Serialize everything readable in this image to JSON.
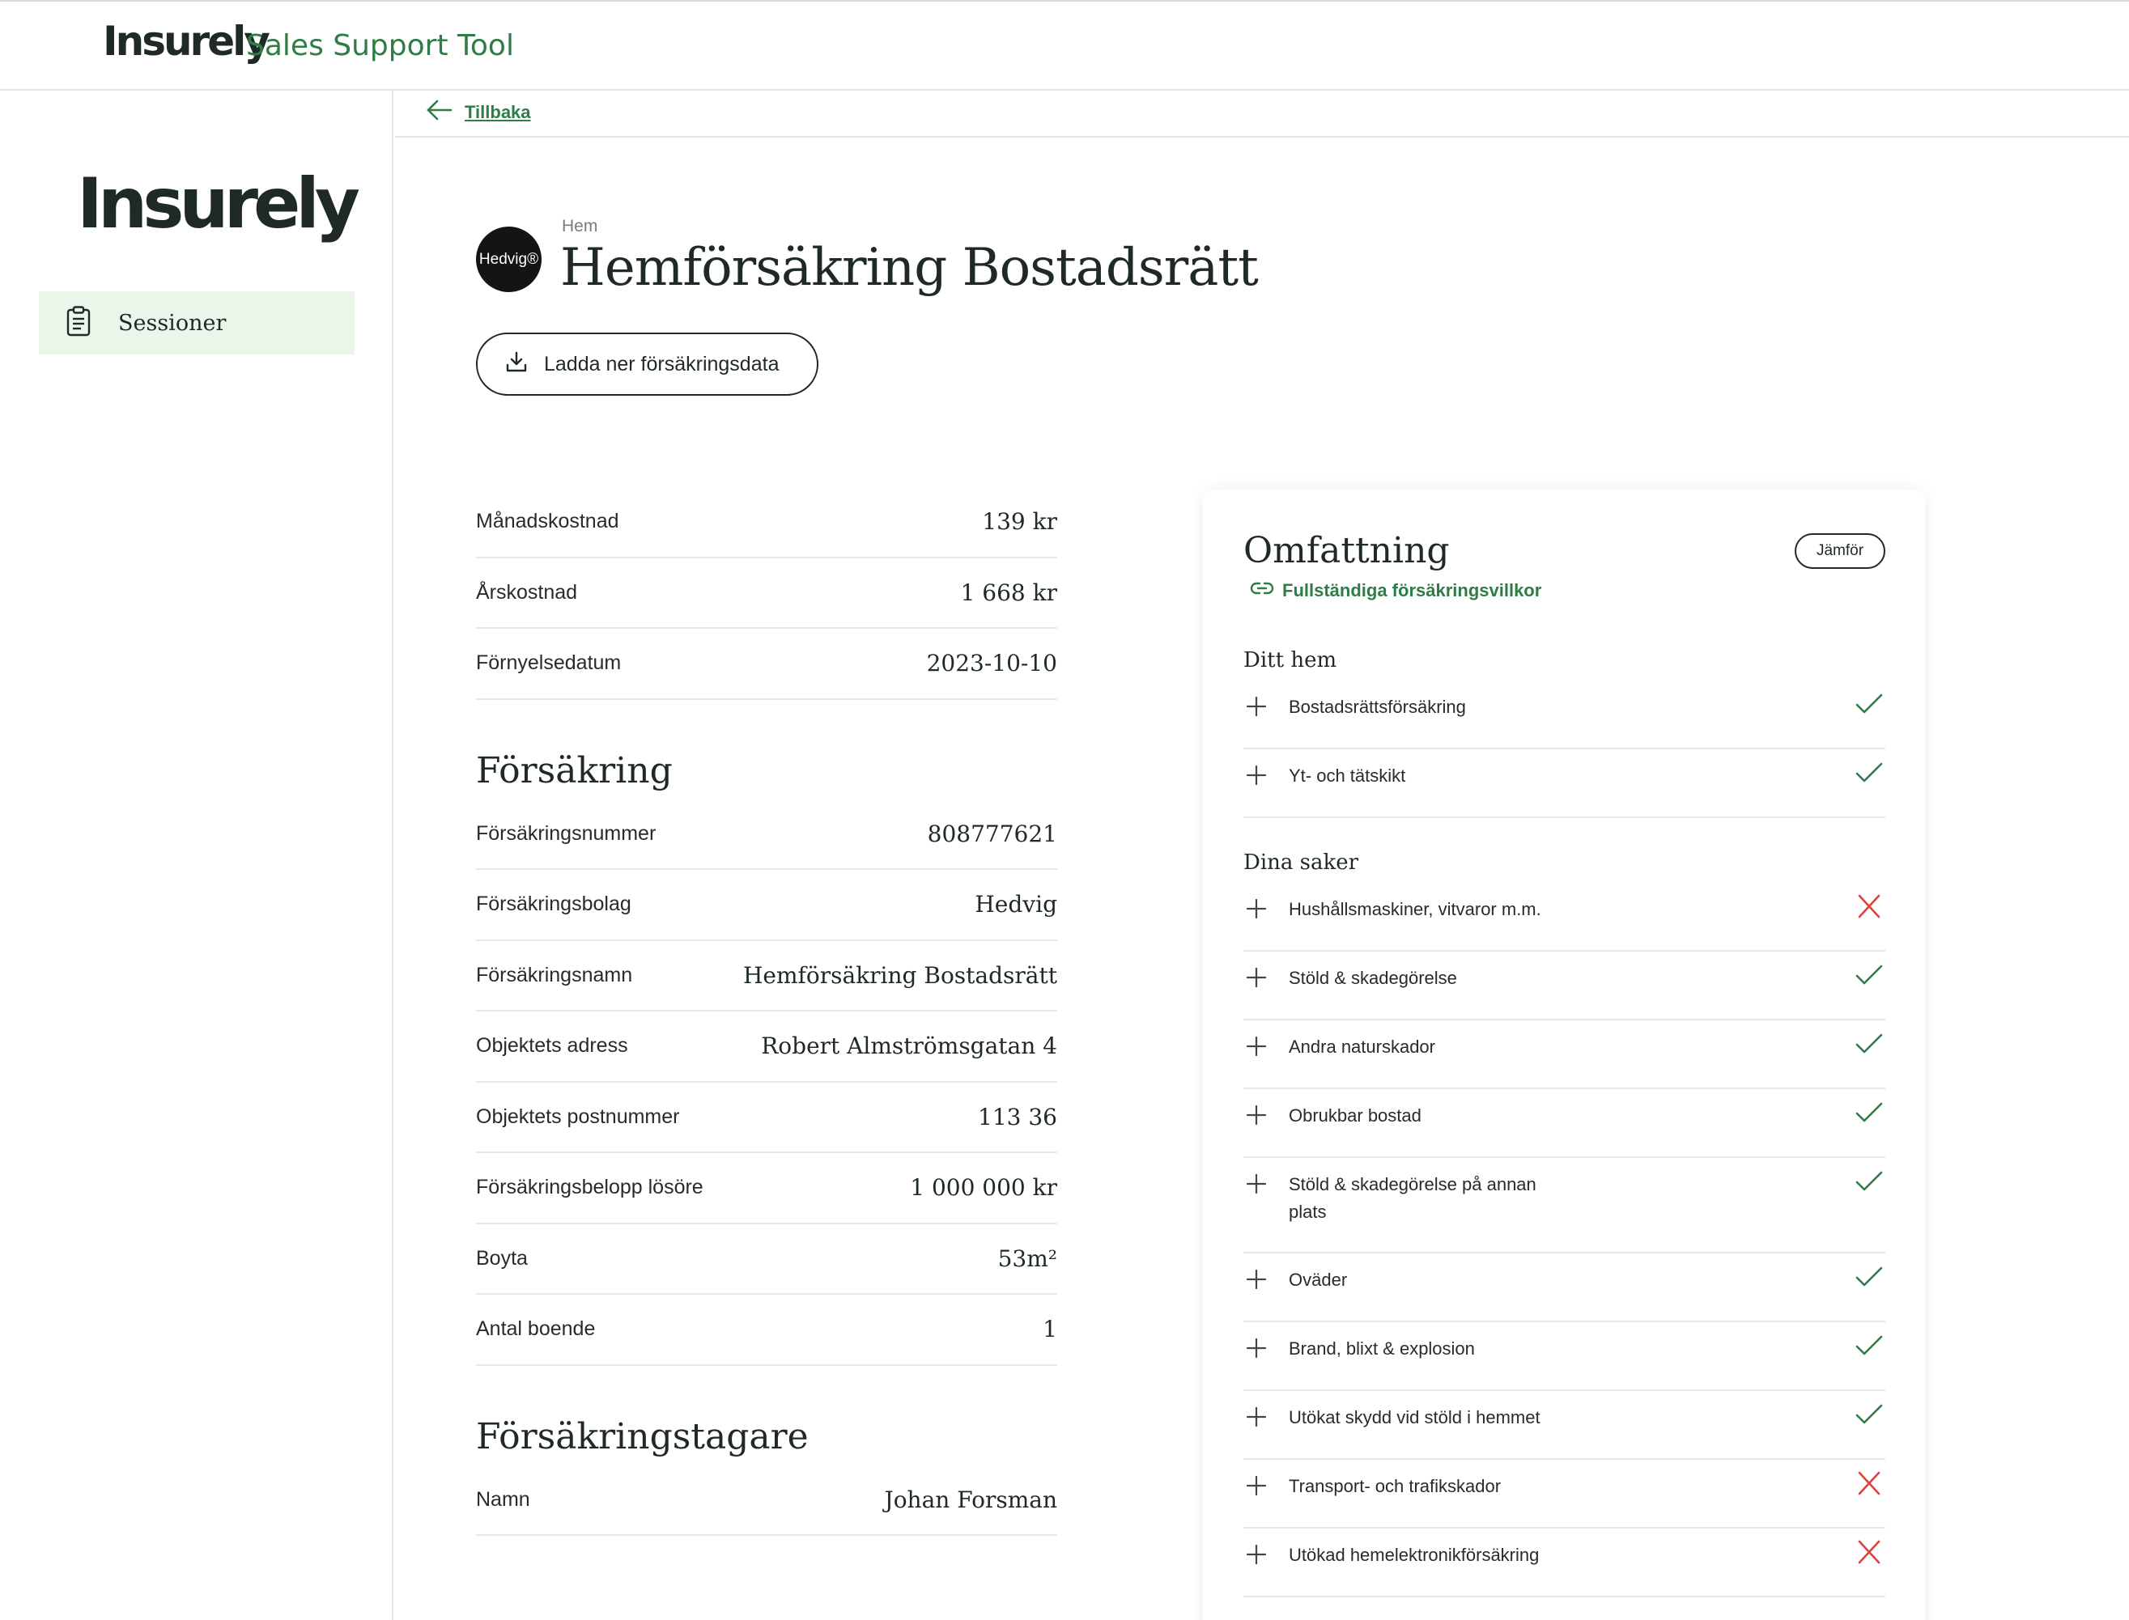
{
  "topbar": {
    "brand": "Insurely",
    "tool_name": "Sales Support Tool"
  },
  "sidebar": {
    "logo": "Insurely",
    "items": [
      {
        "label": "Sessioner",
        "icon": "clipboard-icon"
      }
    ]
  },
  "back": {
    "label": "Tillbaka"
  },
  "header": {
    "category": "Hem",
    "title": "Hemförsäkring Bostadsrätt",
    "company_badge": "Hedvig®"
  },
  "download": {
    "label": "Ladda ner försäkringsdata"
  },
  "costs": [
    {
      "label": "Månadskostnad",
      "value": "139 kr"
    },
    {
      "label": "Årskostnad",
      "value": "1 668 kr"
    },
    {
      "label": "Förnyelsedatum",
      "value": "2023-10-10"
    }
  ],
  "insurance": {
    "title": "Försäkring",
    "rows": [
      {
        "label": "Försäkringsnummer",
        "value": "808777621"
      },
      {
        "label": "Försäkringsbolag",
        "value": "Hedvig"
      },
      {
        "label": "Försäkringsnamn",
        "value": "Hemförsäkring Bostadsrätt"
      },
      {
        "label": "Objektets adress",
        "value": "Robert Almströmsgatan 4"
      },
      {
        "label": "Objektets postnummer",
        "value": "113 36"
      },
      {
        "label": "Försäkringsbelopp lösöre",
        "value": "1 000 000 kr"
      },
      {
        "label": "Boyta",
        "value": "53m²"
      },
      {
        "label": "Antal boende",
        "value": "1"
      }
    ]
  },
  "policyholder": {
    "title": "Försäkringstagare",
    "rows": [
      {
        "label": "Namn",
        "value": "Johan Forsman"
      }
    ]
  },
  "coverage": {
    "title": "Omfattning",
    "compare_label": "Jämför",
    "terms_link": "Fullständiga försäkringsvillkor",
    "colors": {
      "included": "#2f7d46",
      "excluded": "#e0413a"
    },
    "groups": [
      {
        "title": "Ditt hem",
        "items": [
          {
            "label": "Bostadsrättsförsäkring",
            "included": true
          },
          {
            "label": "Yt- och tätskikt",
            "included": true
          }
        ]
      },
      {
        "title": "Dina saker",
        "items": [
          {
            "label": "Hushållsmaskiner, vitvaror m.m.",
            "included": false
          },
          {
            "label": "Stöld & skadegörelse",
            "included": true
          },
          {
            "label": "Andra naturskador",
            "included": true
          },
          {
            "label": "Obrukbar bostad",
            "included": true
          },
          {
            "label": "Stöld & skadegörelse på annan plats",
            "included": true
          },
          {
            "label": "Oväder",
            "included": true
          },
          {
            "label": "Brand, blixt & explosion",
            "included": true
          },
          {
            "label": "Utökat skydd vid stöld i hemmet",
            "included": true
          },
          {
            "label": "Transport- och trafikskador",
            "included": false
          },
          {
            "label": "Utökad hemelektronikförsäkring",
            "included": false
          }
        ]
      }
    ]
  }
}
